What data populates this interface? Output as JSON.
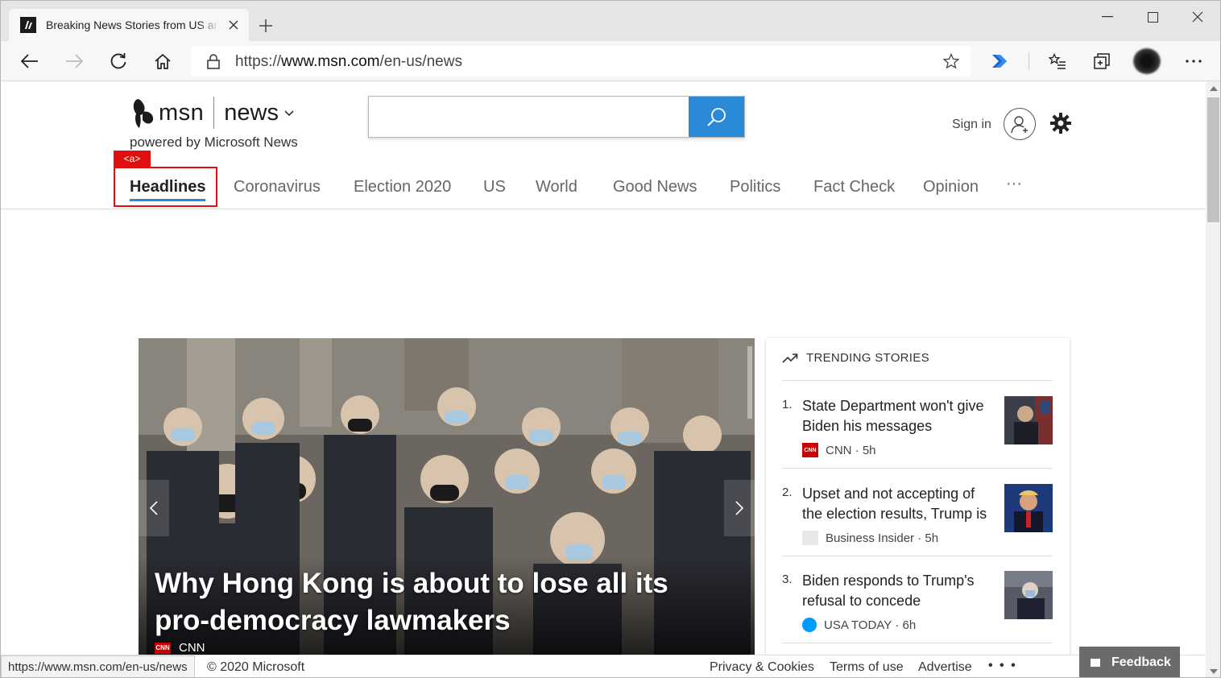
{
  "browser": {
    "tab_title": "Breaking News Stories from US and Around the World",
    "url_prefix": "https://",
    "url_host": "www.msn.com",
    "url_path": "/en-us/news"
  },
  "header": {
    "brand": "msn",
    "section": "news",
    "powered_by": "powered by Microsoft News",
    "search_placeholder": "",
    "sign_in": "Sign in"
  },
  "nav": {
    "items": [
      "Headlines",
      "Coronavirus",
      "Election 2020",
      "US",
      "World",
      "Good News",
      "Politics",
      "Fact Check",
      "Opinion"
    ],
    "more": "···",
    "highlight_tag": "<a>"
  },
  "hero": {
    "title": "Why Hong Kong is about to lose all its pro-democracy lawmakers",
    "source": "CNN",
    "source_logo": "CNN"
  },
  "trending": {
    "heading": "TRENDING STORIES",
    "stories": [
      {
        "num": "1.",
        "title": "State Department won't give Biden his messages",
        "source": "CNN",
        "time": "5h",
        "logo_color": "#cc0000",
        "logo_text": "CNN"
      },
      {
        "num": "2.",
        "title": "Upset and not accepting of the election results, Trump is 'sulking' and out of public view",
        "source": "Business Insider",
        "time": "5h",
        "logo_color": "#dddddd",
        "logo_text": ""
      },
      {
        "num": "3.",
        "title": "Biden responds to Trump's refusal to concede",
        "source": "USA TODAY",
        "time": "6h",
        "logo_color": "#009bff",
        "logo_text": ""
      }
    ]
  },
  "status": {
    "url": "https://www.msn.com/en-us/news",
    "copyright": "© 2020 Microsoft",
    "links": [
      "Privacy & Cookies",
      "Terms of use",
      "Advertise"
    ],
    "more": "• • •",
    "feedback": "Feedback"
  },
  "colors": {
    "accent": "#2b8ad8",
    "highlight": "#e01010"
  }
}
